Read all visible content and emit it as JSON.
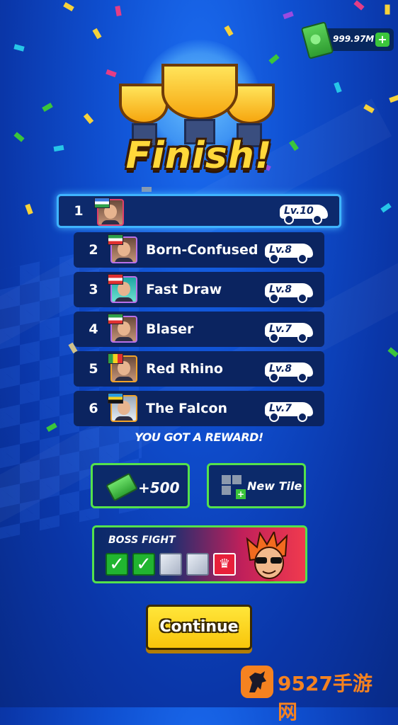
{
  "header": {
    "currency_value": "999.97M",
    "currency_add": "+",
    "title": "Finish!"
  },
  "leaderboard": [
    {
      "rank": "1",
      "name": "",
      "level": "Lv.10",
      "is_player": true,
      "flag": [
        "#3a7adf",
        "#ffffff",
        "#2ea04a"
      ]
    },
    {
      "rank": "2",
      "name": "Born-Confused",
      "level": "Lv.8",
      "flag": [
        "#2ea04a",
        "#ffffff",
        "#e03030"
      ]
    },
    {
      "rank": "3",
      "name": "Fast Draw",
      "level": "Lv.8",
      "flag": [
        "#e03030",
        "#ffffff",
        "#e03030"
      ]
    },
    {
      "rank": "4",
      "name": "Blaser",
      "level": "Lv.7",
      "flag": [
        "#2ea04a",
        "#ffffff",
        "#e03030"
      ]
    },
    {
      "rank": "5",
      "name": "Red Rhino",
      "level": "Lv.8",
      "flag": [
        "#2ea04a",
        "#f5d020",
        "#e03030"
      ]
    },
    {
      "rank": "6",
      "name": "The Falcon",
      "level": "Lv.7",
      "flag": [
        "#2b9be0",
        "#f5d020",
        "#111111"
      ]
    }
  ],
  "reward": {
    "heading": "YOU GOT A REWARD!",
    "cash": "+500",
    "tile": "New Tile"
  },
  "boss": {
    "title": "BOSS FIGHT",
    "steps_done": 2,
    "steps_total": 5
  },
  "actions": {
    "continue": "Continue"
  },
  "watermark": {
    "text": "9527手游网"
  },
  "colors": {
    "accent_green": "#54e24b",
    "highlight_blue": "#3fb4ff",
    "button_yellow": "#f8c50a"
  }
}
